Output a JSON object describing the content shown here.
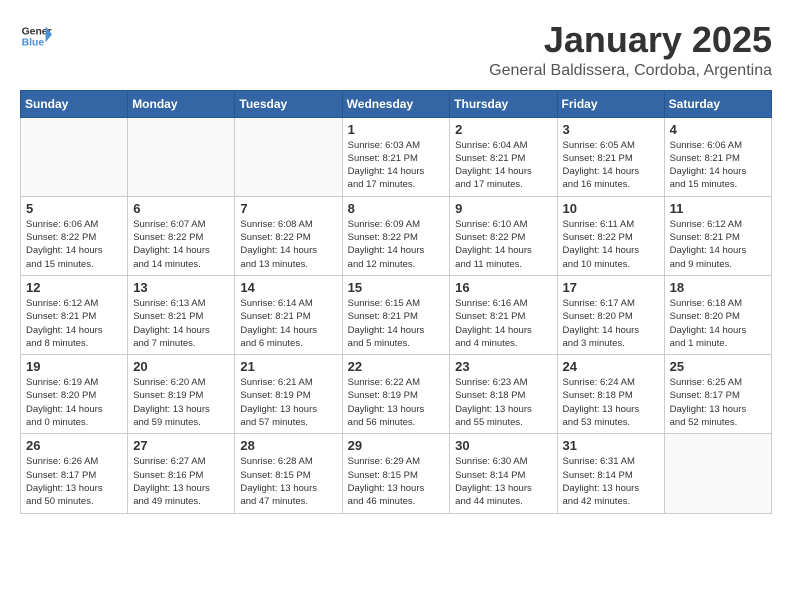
{
  "logo": {
    "general": "General",
    "blue": "Blue"
  },
  "title": "January 2025",
  "location": "General Baldissera, Cordoba, Argentina",
  "weekdays": [
    "Sunday",
    "Monday",
    "Tuesday",
    "Wednesday",
    "Thursday",
    "Friday",
    "Saturday"
  ],
  "weeks": [
    [
      {
        "day": "",
        "info": ""
      },
      {
        "day": "",
        "info": ""
      },
      {
        "day": "",
        "info": ""
      },
      {
        "day": "1",
        "info": "Sunrise: 6:03 AM\nSunset: 8:21 PM\nDaylight: 14 hours\nand 17 minutes."
      },
      {
        "day": "2",
        "info": "Sunrise: 6:04 AM\nSunset: 8:21 PM\nDaylight: 14 hours\nand 17 minutes."
      },
      {
        "day": "3",
        "info": "Sunrise: 6:05 AM\nSunset: 8:21 PM\nDaylight: 14 hours\nand 16 minutes."
      },
      {
        "day": "4",
        "info": "Sunrise: 6:06 AM\nSunset: 8:21 PM\nDaylight: 14 hours\nand 15 minutes."
      }
    ],
    [
      {
        "day": "5",
        "info": "Sunrise: 6:06 AM\nSunset: 8:22 PM\nDaylight: 14 hours\nand 15 minutes."
      },
      {
        "day": "6",
        "info": "Sunrise: 6:07 AM\nSunset: 8:22 PM\nDaylight: 14 hours\nand 14 minutes."
      },
      {
        "day": "7",
        "info": "Sunrise: 6:08 AM\nSunset: 8:22 PM\nDaylight: 14 hours\nand 13 minutes."
      },
      {
        "day": "8",
        "info": "Sunrise: 6:09 AM\nSunset: 8:22 PM\nDaylight: 14 hours\nand 12 minutes."
      },
      {
        "day": "9",
        "info": "Sunrise: 6:10 AM\nSunset: 8:22 PM\nDaylight: 14 hours\nand 11 minutes."
      },
      {
        "day": "10",
        "info": "Sunrise: 6:11 AM\nSunset: 8:22 PM\nDaylight: 14 hours\nand 10 minutes."
      },
      {
        "day": "11",
        "info": "Sunrise: 6:12 AM\nSunset: 8:21 PM\nDaylight: 14 hours\nand 9 minutes."
      }
    ],
    [
      {
        "day": "12",
        "info": "Sunrise: 6:12 AM\nSunset: 8:21 PM\nDaylight: 14 hours\nand 8 minutes."
      },
      {
        "day": "13",
        "info": "Sunrise: 6:13 AM\nSunset: 8:21 PM\nDaylight: 14 hours\nand 7 minutes."
      },
      {
        "day": "14",
        "info": "Sunrise: 6:14 AM\nSunset: 8:21 PM\nDaylight: 14 hours\nand 6 minutes."
      },
      {
        "day": "15",
        "info": "Sunrise: 6:15 AM\nSunset: 8:21 PM\nDaylight: 14 hours\nand 5 minutes."
      },
      {
        "day": "16",
        "info": "Sunrise: 6:16 AM\nSunset: 8:21 PM\nDaylight: 14 hours\nand 4 minutes."
      },
      {
        "day": "17",
        "info": "Sunrise: 6:17 AM\nSunset: 8:20 PM\nDaylight: 14 hours\nand 3 minutes."
      },
      {
        "day": "18",
        "info": "Sunrise: 6:18 AM\nSunset: 8:20 PM\nDaylight: 14 hours\nand 1 minute."
      }
    ],
    [
      {
        "day": "19",
        "info": "Sunrise: 6:19 AM\nSunset: 8:20 PM\nDaylight: 14 hours\nand 0 minutes."
      },
      {
        "day": "20",
        "info": "Sunrise: 6:20 AM\nSunset: 8:19 PM\nDaylight: 13 hours\nand 59 minutes."
      },
      {
        "day": "21",
        "info": "Sunrise: 6:21 AM\nSunset: 8:19 PM\nDaylight: 13 hours\nand 57 minutes."
      },
      {
        "day": "22",
        "info": "Sunrise: 6:22 AM\nSunset: 8:19 PM\nDaylight: 13 hours\nand 56 minutes."
      },
      {
        "day": "23",
        "info": "Sunrise: 6:23 AM\nSunset: 8:18 PM\nDaylight: 13 hours\nand 55 minutes."
      },
      {
        "day": "24",
        "info": "Sunrise: 6:24 AM\nSunset: 8:18 PM\nDaylight: 13 hours\nand 53 minutes."
      },
      {
        "day": "25",
        "info": "Sunrise: 6:25 AM\nSunset: 8:17 PM\nDaylight: 13 hours\nand 52 minutes."
      }
    ],
    [
      {
        "day": "26",
        "info": "Sunrise: 6:26 AM\nSunset: 8:17 PM\nDaylight: 13 hours\nand 50 minutes."
      },
      {
        "day": "27",
        "info": "Sunrise: 6:27 AM\nSunset: 8:16 PM\nDaylight: 13 hours\nand 49 minutes."
      },
      {
        "day": "28",
        "info": "Sunrise: 6:28 AM\nSunset: 8:15 PM\nDaylight: 13 hours\nand 47 minutes."
      },
      {
        "day": "29",
        "info": "Sunrise: 6:29 AM\nSunset: 8:15 PM\nDaylight: 13 hours\nand 46 minutes."
      },
      {
        "day": "30",
        "info": "Sunrise: 6:30 AM\nSunset: 8:14 PM\nDaylight: 13 hours\nand 44 minutes."
      },
      {
        "day": "31",
        "info": "Sunrise: 6:31 AM\nSunset: 8:14 PM\nDaylight: 13 hours\nand 42 minutes."
      },
      {
        "day": "",
        "info": ""
      }
    ]
  ]
}
